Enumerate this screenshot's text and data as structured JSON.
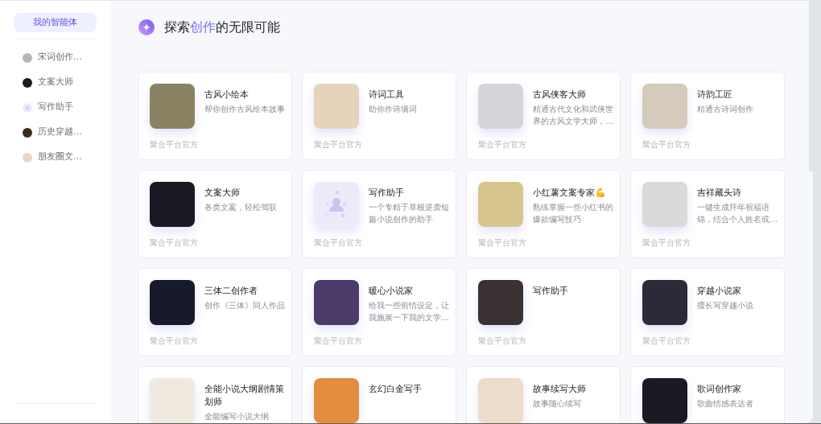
{
  "sidebar": {
    "nav_button": {
      "label": "我的智能体"
    },
    "items": [
      {
        "label": "宋词创作…",
        "selected": false,
        "avatar": {
          "kind": "photo",
          "color": "#b7b6b2"
        }
      },
      {
        "label": "文案大师",
        "selected": false,
        "avatar": {
          "kind": "photo",
          "color": "#1c1b24"
        }
      },
      {
        "label": "写作助手",
        "selected": false,
        "avatar": {
          "kind": "default"
        }
      },
      {
        "label": "历史穿越…",
        "selected": false,
        "avatar": {
          "kind": "photo",
          "color": "#3b2c1e"
        }
      },
      {
        "label": "朋友圈文…",
        "selected": false,
        "avatar": {
          "kind": "photo",
          "color": "#e6d8c6"
        }
      }
    ]
  },
  "header": {
    "title": [
      {
        "text": "探索",
        "highlight": false
      },
      {
        "text": "创作",
        "highlight": true
      },
      {
        "text": "的无限可能",
        "highlight": false
      }
    ]
  },
  "cards": [
    {
      "title": "古风小绘本",
      "description": "帮你创作古风绘本故事",
      "footer": "聚合平台官方",
      "avatar": {
        "kind": "photo",
        "color": "#8a8262"
      }
    },
    {
      "title": "诗词工具",
      "description": "助你作诗填词",
      "footer": "聚合平台官方",
      "avatar": {
        "kind": "photo",
        "color": "#e6d3bb"
      }
    },
    {
      "title": "古风侠客大师",
      "description": "精通古代文化和武侠世界的古风文学大师，…",
      "footer": "聚合平台官方",
      "avatar": {
        "kind": "photo",
        "color": "#d6d3da"
      }
    },
    {
      "title": "诗韵工匠",
      "description": "精通古诗词创作",
      "footer": "聚合平台官方",
      "avatar": {
        "kind": "photo",
        "color": "#d5cbbb"
      }
    },
    {
      "title": "文案大师",
      "description": "各类文案，轻松驾驭",
      "footer": "聚合平台官方",
      "avatar": {
        "kind": "photo",
        "color": "#191823"
      }
    },
    {
      "title": "写作助手",
      "description": "一个专精于草根逆袭短篇小说创作的助手",
      "footer": "聚合平台官方",
      "avatar": {
        "kind": "default"
      }
    },
    {
      "title": "小红薯文案专家",
      "emoji": "💪",
      "description": "熟练掌握一些小红书的爆款编写技巧",
      "footer": "聚合平台官方",
      "avatar": {
        "kind": "photo",
        "color": "#d6c68e"
      }
    },
    {
      "title": "吉祥藏头诗",
      "description": "一键生成拜年祝福语锦，结合个人姓名或…",
      "footer": "聚合平台官方",
      "avatar": {
        "kind": "photo",
        "color": "#dadada"
      }
    },
    {
      "title": "三体二创作者",
      "description": "创作《三体》同人作品",
      "footer": "聚合平台官方",
      "avatar": {
        "kind": "photo",
        "color": "#171a2b"
      }
    },
    {
      "title": "暖心小说家",
      "description": "给我一些前情设定，让我施展一下我的文学…",
      "footer": "聚合平台官方",
      "avatar": {
        "kind": "photo",
        "color": "#4b3b6b"
      }
    },
    {
      "title": "写作助手",
      "footer": "聚合平台官方",
      "avatar": {
        "kind": "photo",
        "color": "#3a3232"
      }
    },
    {
      "title": "穿越小说家",
      "description": "擅长写穿越小说",
      "footer": "聚合平台官方",
      "avatar": {
        "kind": "photo",
        "color": "#2b2a38"
      }
    },
    {
      "title": "全能小说大纲剧情策划师",
      "description": "全能编写小说大纲",
      "avatar": {
        "kind": "photo",
        "color": "#efe9df"
      }
    },
    {
      "title": "玄幻白金写手",
      "avatar": {
        "kind": "photo",
        "color": "#e28d3f"
      }
    },
    {
      "title": "故事续写大师",
      "description": "故事随心续写",
      "avatar": {
        "kind": "photo",
        "color": "#ebdccb"
      }
    },
    {
      "title": "歌词创作家",
      "description": "歌曲情感表达者",
      "avatar": {
        "kind": "photo",
        "color": "#1a1a24"
      }
    }
  ]
}
